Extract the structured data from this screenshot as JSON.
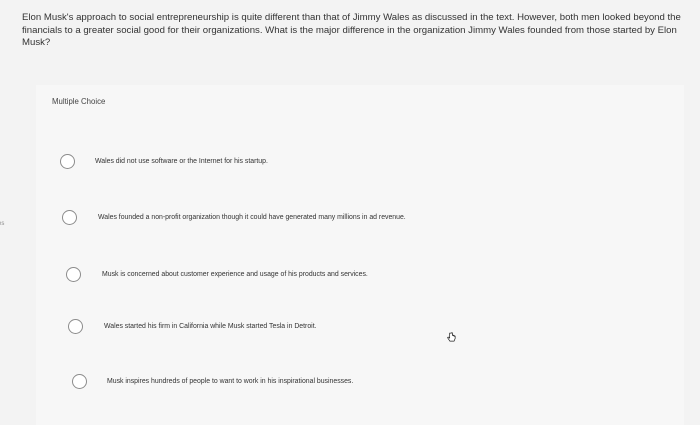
{
  "question": {
    "text": "Elon Musk's approach to social entrepreneurship is quite different than that of Jimmy Wales as discussed in the text. However, both men looked beyond the financials to a greater social good for their organizations. What is the major difference in the organization Jimmy Wales founded from those started by Elon Musk?"
  },
  "side_tab": {
    "text": "es"
  },
  "section": {
    "label": "Multiple Choice"
  },
  "options": [
    {
      "label": "Wales did not use software or the Internet for his startup."
    },
    {
      "label": "Wales founded a non-profit organization though it could have generated many millions in ad revenue."
    },
    {
      "label": "Musk is concerned about customer experience and usage of his products and services."
    },
    {
      "label": "Wales started his firm in California while Musk started Tesla in Detroit."
    },
    {
      "label": "Musk inspires hundreds of people to want to work in his inspirational businesses."
    }
  ],
  "icons": {
    "cursor": "hand-pointer-icon"
  }
}
